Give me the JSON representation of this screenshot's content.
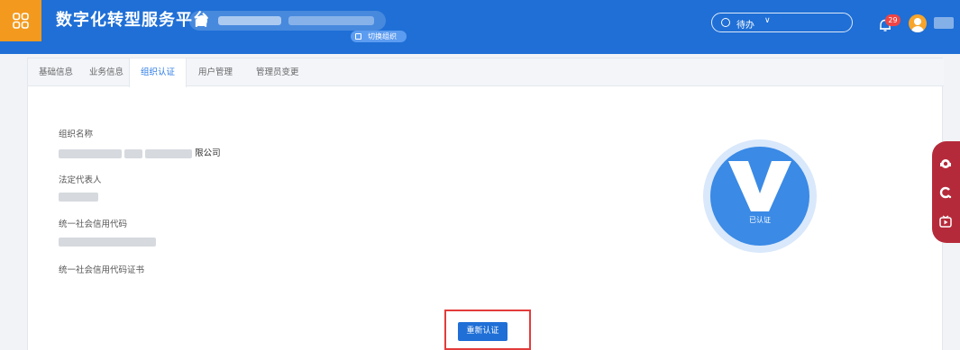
{
  "header": {
    "title": "数字化转型服务平台",
    "switch_org_label": "切换组织",
    "search_label": "待办",
    "search_caret": "∨",
    "notification_count": "29"
  },
  "tabs": [
    {
      "label": "基础信息"
    },
    {
      "label": "业务信息"
    },
    {
      "label": "组织认证",
      "active": true
    },
    {
      "label": "用户管理"
    },
    {
      "label": "管理员变更"
    }
  ],
  "org": {
    "name_label": "组织名称",
    "name_value_suffix": "限公司",
    "legal_rep_label": "法定代表人",
    "credit_code_label": "统一社会信用代码",
    "credit_cert_label": "统一社会信用代码证书"
  },
  "verified": {
    "status_text": "已认证"
  },
  "actions": {
    "recertify_label": "重新认证"
  },
  "colors": {
    "header_bg": "#1f6fd6",
    "logo_bg": "#f39a1e",
    "accent": "#2b7be6",
    "float_bar": "#b52a3a",
    "highlight": "#e43b3b"
  }
}
